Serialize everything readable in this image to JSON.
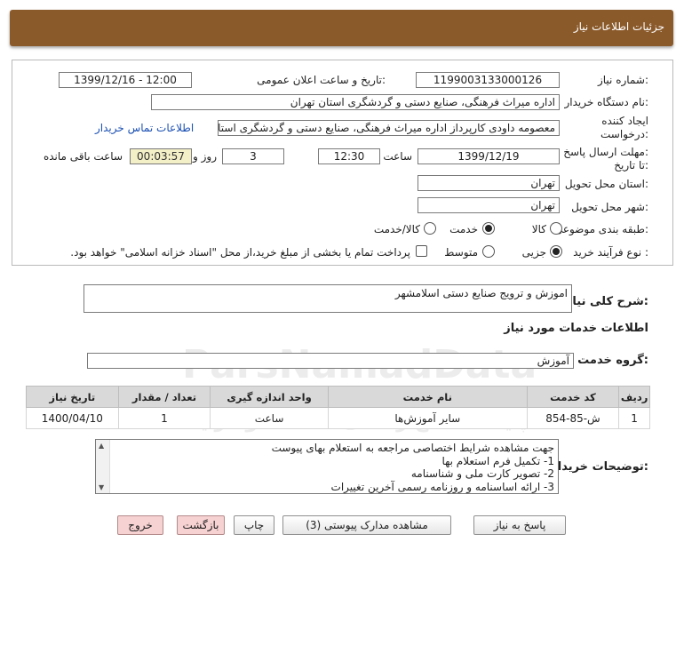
{
  "header": {
    "title": "جزئیات اطلاعات نیاز"
  },
  "form": {
    "need_number_label": "شماره نیاز:",
    "need_number": "1199003133000126",
    "announce_label": "تاریخ و ساعت اعلان عمومی:",
    "announce_value": "1399/12/16 - 12:00",
    "buyer_org_label": "نام دستگاه خریدار:",
    "buyer_org": "اداره میراث فرهنگی، صنایع دستی و گردشگری استان تهران",
    "creator_label_1": "ایجاد کننده",
    "creator_label_2": "درخواست:",
    "creator": "معصومه داودی کارپرداز اداره میراث فرهنگی، صنایع دستی و گردشگری استان تهران",
    "contact_link": "اطلاعات تماس خریدار",
    "deadline_label_1": "مهلت ارسال پاسخ:",
    "deadline_label_2": "تا تاریخ:",
    "deadline_date": "1399/12/19",
    "time_label": "ساعت",
    "deadline_time": "12:30",
    "days_value": "3",
    "days_label": "روز و",
    "remaining_time": "00:03:57",
    "remaining_label": "ساعت باقی مانده",
    "province_label": "استان محل تحویل:",
    "province": "تهران",
    "city_label": "شهر محل تحویل:",
    "city": "تهران",
    "category_label": "طبقه بندی موضوعی:",
    "category_options": [
      "کالا",
      "خدمت",
      "کالا/خدمت"
    ],
    "process_label": "نوع فرآیند خرید :",
    "process_options": [
      "جزیی",
      "متوسط"
    ],
    "payment_note": "پرداخت تمام یا بخشی از مبلغ خرید،از محل \"اسناد خزانه اسلامی\" خواهد بود."
  },
  "summary": {
    "label": "شرح کلی نیاز:",
    "value": "اموزش و ترویج صنایع دستی اسلامشهر"
  },
  "services": {
    "section_title": "اطلاعات خدمات مورد نیاز",
    "group_label": "گروه خدمت:",
    "group_value": "آموزش"
  },
  "table": {
    "headers": [
      "ردیف",
      "کد خدمت",
      "نام خدمت",
      "واحد اندازه گیری",
      "تعداد / مقدار",
      "تاریخ نیاز"
    ],
    "rows": [
      [
        "1",
        "ش-85-854",
        "سایر آموزش‌ها",
        "ساعت",
        "1",
        "1400/04/10"
      ]
    ]
  },
  "notes": {
    "label": "توضیحات خریدار:",
    "lines": [
      "جهت مشاهده شرایط اختصاصی مراجعه به استعلام بهای پیوست",
      "1- تکمیل فرم استعلام بها",
      "2- تصویر کارت ملی و شناسنامه",
      "3- ارائه اساسنامه و روزنامه رسمی آخرین تغییرات"
    ]
  },
  "buttons": {
    "reply": "پاسخ به نیاز",
    "attachments": "مشاهده مدارک پیوستی (3)",
    "print": "چاپ",
    "back": "بازگشت",
    "exit": "خروج"
  },
  "watermark": {
    "line1": "ParsNamadData",
    "line2": "مرکز فراوری اطلاعات پارس نماد داده",
    "line3": "پایگاه اطلاع رسانی مناقصه و مزایده",
    "phone": "۰۲۱-۸۸۳۴۹۶۷۰",
    "digits": "010101"
  },
  "colors": {
    "header_bg": "#8b5a2b",
    "link": "#1a4fb3",
    "timer_bg": "#f3efc7",
    "exit_btn": "#f7d2d2"
  }
}
